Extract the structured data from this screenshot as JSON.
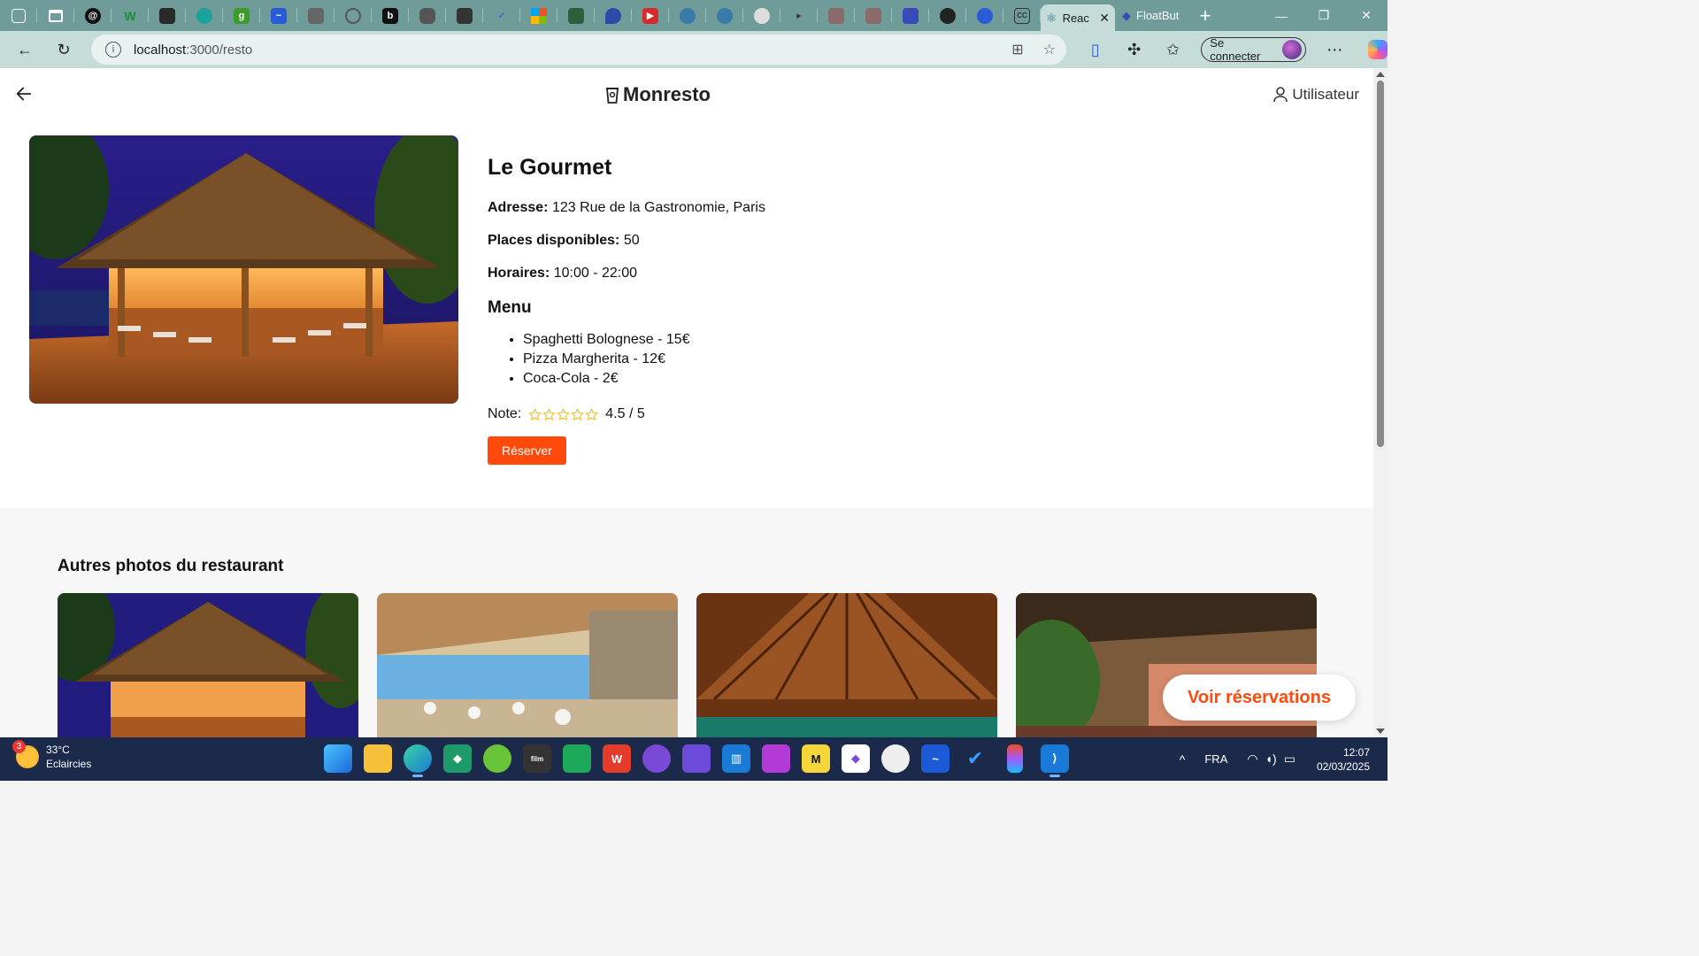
{
  "browser": {
    "tabs": [
      {
        "title": "Reac",
        "icon": "react-icon",
        "active": true
      },
      {
        "title": "FloatBut",
        "icon": "diamond-icon",
        "active": false
      }
    ],
    "url_host": "localhost",
    "url_path": ":3000/resto",
    "signin_label": "Se connecter"
  },
  "navbar": {
    "brand": "Monresto",
    "user_label": "Utilisateur"
  },
  "restaurant": {
    "name": "Le Gourmet",
    "address_label": "Adresse:",
    "address": "123 Rue de la Gastronomie, Paris",
    "seats_label": "Places disponibles:",
    "seats": "50",
    "hours_label": "Horaires:",
    "hours": "10:00 - 22:00",
    "menu_title": "Menu",
    "menu": [
      "Spaghetti Bolognese - 15€",
      "Pizza Margherita - 12€",
      "Coca-Cola - 2€"
    ],
    "rating_label": "Note:",
    "rating_value": 4.5,
    "rating_max": 5,
    "rating_text": "4.5 / 5",
    "reserve_label": "Réserver"
  },
  "gallery": {
    "title": "Autres photos du restaurant"
  },
  "float_button": {
    "label": "Voir réservations"
  },
  "taskbar": {
    "weather_temp": "33°C",
    "weather_desc": "Eclaircies",
    "weather_badge": "3",
    "lang": "FRA",
    "time": "12:07",
    "date": "02/03/2025"
  },
  "colors": {
    "accent": "#ff4a0c",
    "browser_frame": "#6f9b98",
    "taskbar": "#1b2a4a"
  }
}
